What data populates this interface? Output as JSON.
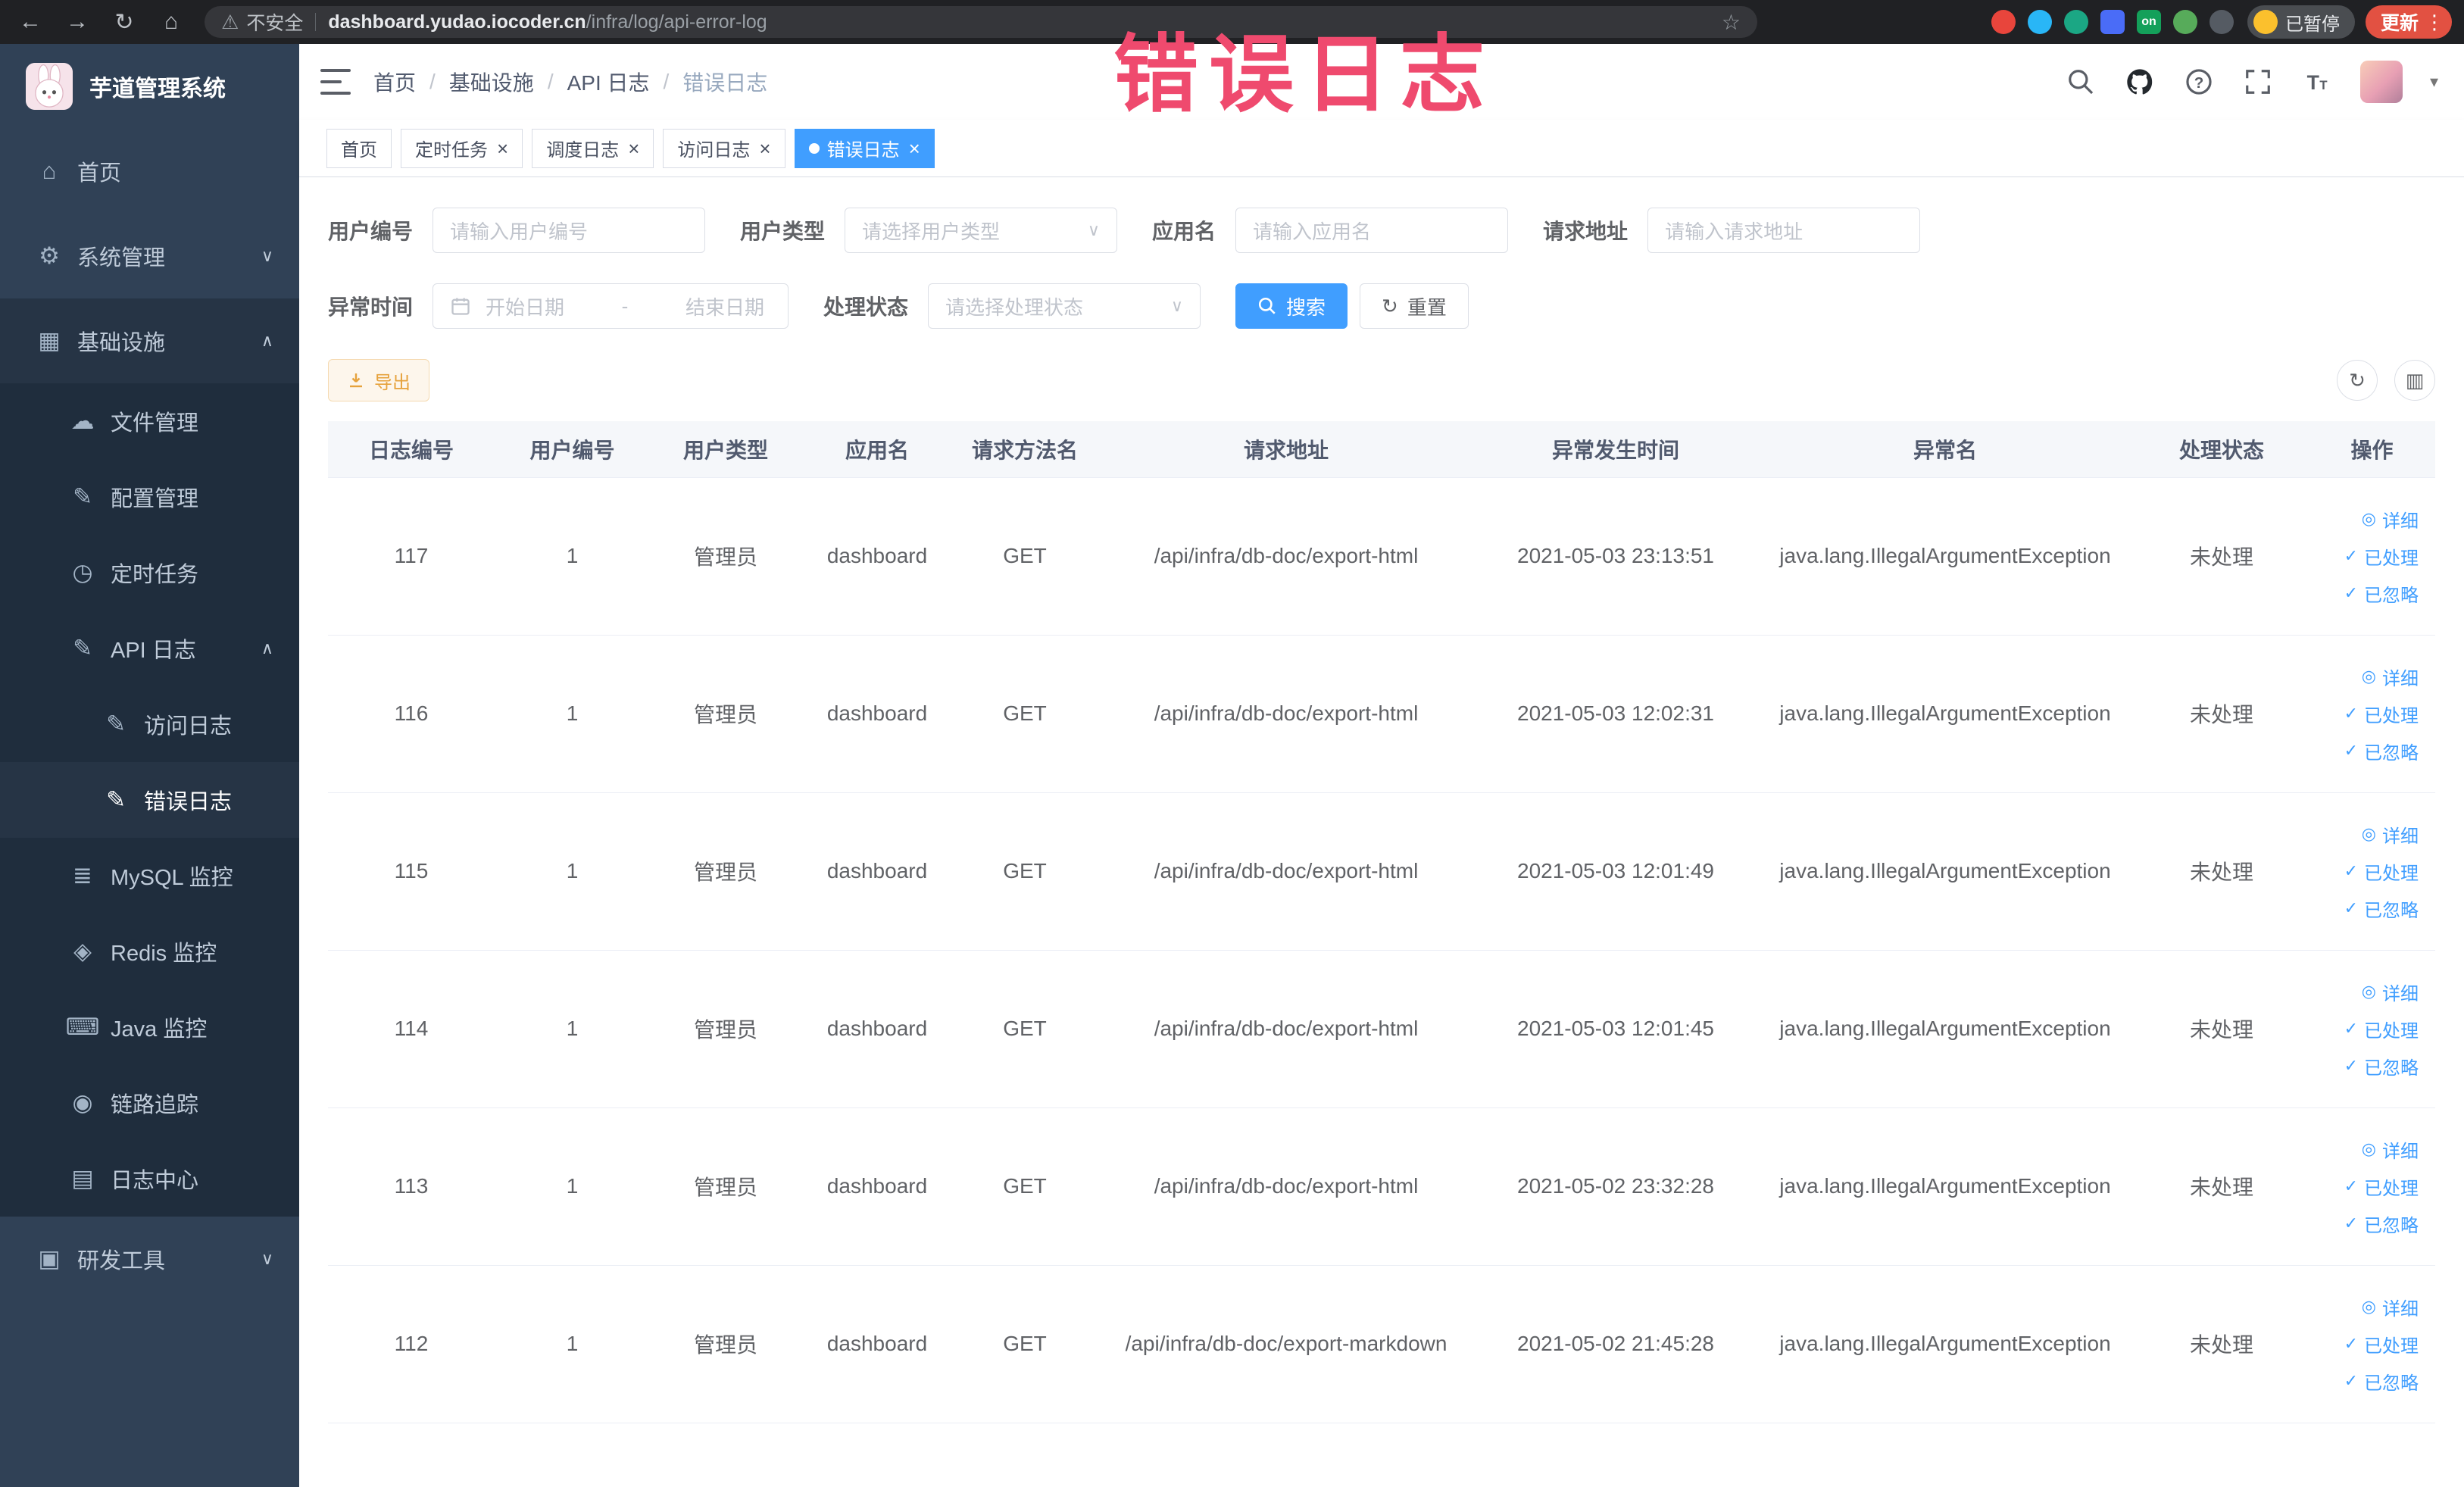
{
  "colors": {
    "primary": "#409eff",
    "warning": "#e6a23c",
    "sidebar_bg": "#304156",
    "sidebar_submenu_bg": "#1f2d3d",
    "annotation": "#ef4a6e"
  },
  "annotation": {
    "text": "错误日志"
  },
  "browser": {
    "security_label": "不安全",
    "url_host": "dashboard.yudao.iocoder.cn",
    "url_path": "/infra/log/api-error-log",
    "profile_chip": "已暂停",
    "update_button": "更新",
    "extensions": [
      {
        "name": "red-circle-extension-icon",
        "color": "#e8453c",
        "shape": "ci"
      },
      {
        "name": "blue-drop-extension-icon",
        "color": "#29b6f6",
        "shape": "ci"
      },
      {
        "name": "teal-circle-extension-icon",
        "color": "#1ba784",
        "shape": "ci"
      },
      {
        "name": "blue-grid-extension-icon",
        "color": "#4a6cf7",
        "shape": "sq"
      },
      {
        "name": "green-on-extension-icon",
        "color": "#14a05a",
        "shape": "sq",
        "text": "on"
      },
      {
        "name": "green-leaf-extension-icon",
        "color": "#57ab5a",
        "shape": "ci"
      },
      {
        "name": "dark-plug-extension-icon",
        "color": "#555b63",
        "shape": "ci"
      }
    ]
  },
  "sidebar": {
    "logo_title": "芋道管理系统",
    "items": [
      {
        "name": "home",
        "label": "首页",
        "icon": "home-icon",
        "depth": 0
      },
      {
        "name": "system-management",
        "label": "系统管理",
        "icon": "gear-icon",
        "depth": 0,
        "chevron": "down"
      },
      {
        "name": "infrastructure",
        "label": "基础设施",
        "icon": "grid-icon",
        "depth": 0,
        "chevron": "up",
        "open": true
      },
      {
        "name": "file-management",
        "label": "文件管理",
        "icon": "folder-icon",
        "depth": 1
      },
      {
        "name": "config-management",
        "label": "配置管理",
        "icon": "edit-icon",
        "depth": 1
      },
      {
        "name": "scheduled-jobs",
        "label": "定时任务",
        "icon": "timer-icon",
        "depth": 1
      },
      {
        "name": "api-log",
        "label": "API 日志",
        "icon": "api-log-icon",
        "depth": 1,
        "chevron": "up"
      },
      {
        "name": "access-log",
        "label": "访问日志",
        "icon": "doc-icon",
        "depth": 2
      },
      {
        "name": "error-log",
        "label": "错误日志",
        "icon": "doc-icon",
        "depth": 2,
        "active": true
      },
      {
        "name": "mysql-monitor",
        "label": "MySQL 监控",
        "icon": "database-icon",
        "depth": 1
      },
      {
        "name": "redis-monitor",
        "label": "Redis 监控",
        "icon": "redis-icon",
        "depth": 1
      },
      {
        "name": "java-monitor",
        "label": "Java 监控",
        "icon": "java-icon",
        "depth": 1
      },
      {
        "name": "trace",
        "label": "链路追踪",
        "icon": "trace-icon",
        "depth": 1
      },
      {
        "name": "log-center",
        "label": "日志中心",
        "icon": "log-center-icon",
        "depth": 1
      },
      {
        "name": "dev-tools",
        "label": "研发工具",
        "icon": "tools-icon",
        "depth": 0,
        "chevron": "down"
      }
    ]
  },
  "header": {
    "breadcrumb": [
      "首页",
      "基础设施",
      "API 日志",
      "错误日志"
    ],
    "icons": [
      "search-icon",
      "github-icon",
      "help-icon",
      "fullscreen-icon",
      "font-size-icon",
      "avatar",
      "chevron-down-icon"
    ]
  },
  "tabs": [
    {
      "name": "home",
      "label": "首页",
      "closable": false,
      "active": false
    },
    {
      "name": "job",
      "label": "定时任务",
      "closable": true,
      "active": false
    },
    {
      "name": "job-log",
      "label": "调度日志",
      "closable": true,
      "active": false
    },
    {
      "name": "api-access-log",
      "label": "访问日志",
      "closable": true,
      "active": false
    },
    {
      "name": "api-error-log",
      "label": "错误日志",
      "closable": true,
      "active": true
    }
  ],
  "filters": {
    "user_id": {
      "label": "用户编号",
      "placeholder": "请输入用户编号"
    },
    "user_type": {
      "label": "用户类型",
      "placeholder": "请选择用户类型"
    },
    "app_name": {
      "label": "应用名",
      "placeholder": "请输入应用名"
    },
    "request_url": {
      "label": "请求地址",
      "placeholder": "请输入请求地址"
    },
    "exception_time": {
      "label": "异常时间",
      "start_placeholder": "开始日期",
      "separator": "-",
      "end_placeholder": "结束日期"
    },
    "process_status": {
      "label": "处理状态",
      "placeholder": "请选择处理状态"
    },
    "search_button": "搜索",
    "reset_button": "重置"
  },
  "toolbar": {
    "export_button": "导出"
  },
  "table": {
    "columns": [
      "日志编号",
      "用户编号",
      "用户类型",
      "应用名",
      "请求方法名",
      "请求地址",
      "异常发生时间",
      "异常名",
      "处理状态",
      "操作"
    ],
    "row_actions": [
      {
        "name": "detail",
        "icon": "view-icon",
        "label": "详细"
      },
      {
        "name": "processed",
        "icon": "check-icon",
        "label": "已处理"
      },
      {
        "name": "ignored",
        "icon": "check-icon",
        "label": "已忽略"
      }
    ],
    "rows": [
      [
        "117",
        "1",
        "管理员",
        "dashboard",
        "GET",
        "/api/infra/db-doc/export-html",
        "2021-05-03 23:13:51",
        "java.lang.IllegalArgumentException",
        "未处理"
      ],
      [
        "116",
        "1",
        "管理员",
        "dashboard",
        "GET",
        "/api/infra/db-doc/export-html",
        "2021-05-03 12:02:31",
        "java.lang.IllegalArgumentException",
        "未处理"
      ],
      [
        "115",
        "1",
        "管理员",
        "dashboard",
        "GET",
        "/api/infra/db-doc/export-html",
        "2021-05-03 12:01:49",
        "java.lang.IllegalArgumentException",
        "未处理"
      ],
      [
        "114",
        "1",
        "管理员",
        "dashboard",
        "GET",
        "/api/infra/db-doc/export-html",
        "2021-05-03 12:01:45",
        "java.lang.IllegalArgumentException",
        "未处理"
      ],
      [
        "113",
        "1",
        "管理员",
        "dashboard",
        "GET",
        "/api/infra/db-doc/export-html",
        "2021-05-02 23:32:28",
        "java.lang.IllegalArgumentException",
        "未处理"
      ],
      [
        "112",
        "1",
        "管理员",
        "dashboard",
        "GET",
        "/api/infra/db-doc/export-markdown",
        "2021-05-02 21:45:28",
        "java.lang.IllegalArgumentException",
        "未处理"
      ]
    ]
  }
}
